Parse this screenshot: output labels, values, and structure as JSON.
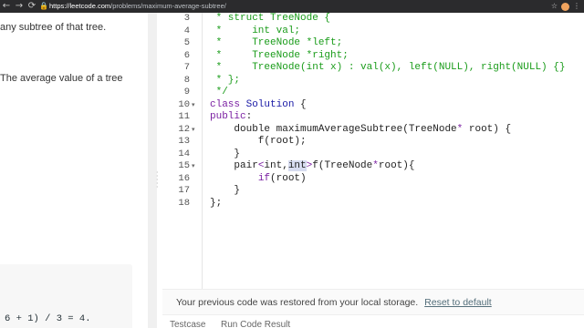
{
  "browser": {
    "back_icon": "arrow-left-icon",
    "forward_icon": "arrow-right-icon",
    "reload_icon": "reload-icon",
    "lock_icon": "lock-icon",
    "url_host": "https://leetcode.com",
    "url_path": "/problems/maximum-average-subtree/",
    "star_icon": "star-icon",
    "menu_icon": "more-vertical-icon"
  },
  "description": {
    "line1": "any subtree of that tree.",
    "line2": "The average value of a tree",
    "example_output": "6 + 1) / 3 = 4."
  },
  "editor": {
    "lines": [
      {
        "n": "3",
        "fold": "",
        "parts": [
          {
            "t": " * struct TreeNode {",
            "c": "cm"
          }
        ]
      },
      {
        "n": "4",
        "fold": "",
        "parts": [
          {
            "t": " *     int val;",
            "c": "cm"
          }
        ]
      },
      {
        "n": "5",
        "fold": "",
        "parts": [
          {
            "t": " *     TreeNode *left;",
            "c": "cm"
          }
        ]
      },
      {
        "n": "6",
        "fold": "",
        "parts": [
          {
            "t": " *     TreeNode *right;",
            "c": "cm"
          }
        ]
      },
      {
        "n": "7",
        "fold": "",
        "parts": [
          {
            "t": " *     TreeNode(int x) : val(x), left(NULL), right(NULL) {}",
            "c": "cm"
          }
        ]
      },
      {
        "n": "8",
        "fold": "",
        "parts": [
          {
            "t": " * };",
            "c": "cm"
          }
        ]
      },
      {
        "n": "9",
        "fold": "",
        "parts": [
          {
            "t": " */",
            "c": "cm"
          }
        ]
      },
      {
        "n": "10",
        "fold": "▾",
        "parts": [
          {
            "t": "class ",
            "c": "kw"
          },
          {
            "t": "Solution",
            "c": "ty"
          },
          {
            "t": " {",
            "c": ""
          }
        ]
      },
      {
        "n": "11",
        "fold": "",
        "parts": [
          {
            "t": "public",
            "c": "kw"
          },
          {
            "t": ":",
            "c": ""
          }
        ]
      },
      {
        "n": "12",
        "fold": "▾",
        "parts": [
          {
            "t": "    double maximumAverageSubtree(TreeNode",
            "c": ""
          },
          {
            "t": "*",
            "c": "kw"
          },
          {
            "t": " root) {",
            "c": ""
          }
        ]
      },
      {
        "n": "13",
        "fold": "",
        "parts": [
          {
            "t": "        f(root);",
            "c": ""
          }
        ]
      },
      {
        "n": "14",
        "fold": "",
        "parts": [
          {
            "t": "    }",
            "c": ""
          }
        ]
      },
      {
        "n": "15",
        "fold": "▾",
        "parts": [
          {
            "t": "    pair",
            "c": ""
          },
          {
            "t": "<",
            "c": "kw"
          },
          {
            "t": "int,",
            "c": ""
          },
          {
            "t": "int",
            "c": "hl"
          },
          {
            "t": ">",
            "c": "kw"
          },
          {
            "t": "f(TreeNode",
            "c": ""
          },
          {
            "t": "*",
            "c": "kw"
          },
          {
            "t": "root){",
            "c": ""
          }
        ]
      },
      {
        "n": "16",
        "fold": "",
        "parts": [
          {
            "t": "        ",
            "c": ""
          },
          {
            "t": "if",
            "c": "kw"
          },
          {
            "t": "(root)",
            "c": ""
          }
        ]
      },
      {
        "n": "17",
        "fold": "",
        "parts": [
          {
            "t": "    }",
            "c": ""
          }
        ]
      },
      {
        "n": "18",
        "fold": "",
        "parts": [
          {
            "t": "};",
            "c": ""
          }
        ]
      }
    ]
  },
  "restore": {
    "message": "Your previous code was restored from your local storage.",
    "reset_link": "Reset to default"
  },
  "bottom_tabs": {
    "testcase": "Testcase",
    "run_code_result": "Run Code Result"
  }
}
